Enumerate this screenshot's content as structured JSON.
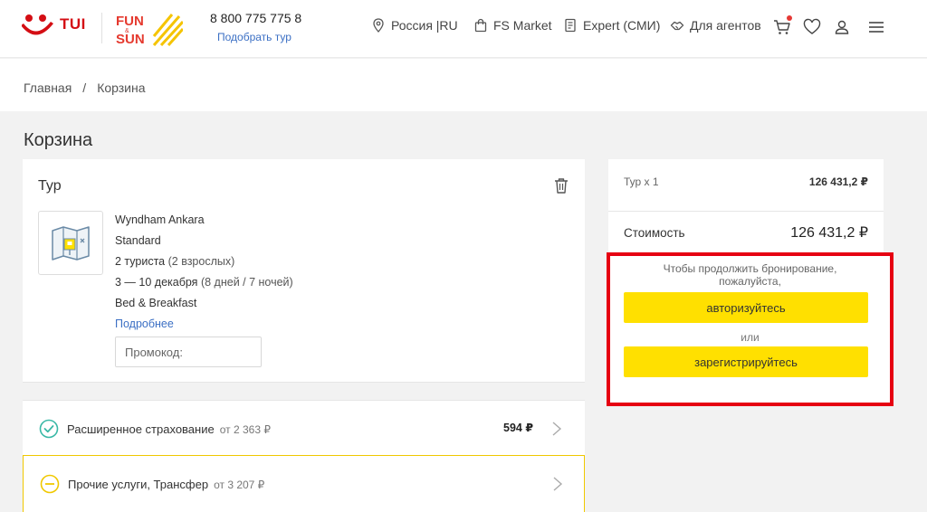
{
  "header": {
    "brand": "TUI",
    "fs_logo": "FUN & SUN",
    "phone": "8 800 775 775 8",
    "pick_tour": "Подобрать тур",
    "nav": [
      {
        "label": "Россия |RU",
        "icon": "location-pin-icon"
      },
      {
        "label": "FS Market",
        "icon": "shopping-bag-icon"
      },
      {
        "label": "Expert (СМИ)",
        "icon": "document-icon"
      },
      {
        "label": "Для агентов",
        "icon": "handshake-icon"
      }
    ],
    "icons": [
      "cart-icon",
      "heart-icon",
      "user-icon",
      "menu-icon"
    ],
    "accent": "#d40e14"
  },
  "breadcrumb": {
    "home": "Главная",
    "separator": "/",
    "current": "Корзина"
  },
  "page": {
    "title": "Корзина"
  },
  "tour": {
    "title": "Тур",
    "hotel": "Wyndham Ankara",
    "room": "Standard",
    "tourists": "2 туриста",
    "tourists_detail": "(2 взрослых)",
    "dates": "3 — 10 декабря",
    "dates_detail": "(8 дней / 7 ночей)",
    "meal": "Bed & Breakfast",
    "more_link": "Подробнее",
    "promo_placeholder": "Промокод:"
  },
  "services": [
    {
      "label": "Расширенное страхование",
      "from": "от 2 363 ₽",
      "price": "594 ₽",
      "icon": "check-circle-icon",
      "color": "#39b8a6"
    },
    {
      "label": "Прочие услуги, Трансфер",
      "from": "от 3 207 ₽",
      "price": "",
      "icon": "minus-circle-icon",
      "color": "#f0c800"
    }
  ],
  "summary": {
    "row_label": "Тур x 1",
    "row_value": "126 431,2 ₽",
    "total_label": "Стоимость",
    "total_value": "126 431,2 ₽",
    "auth_text_1": "Чтобы продолжить бронирование,",
    "auth_text_2": "пожалуйста,",
    "login_button": "авторизуйтесь",
    "or": "или",
    "register_button": "зарегистрируйтесь",
    "button_color": "#ffe000",
    "highlight_color": "#e60012"
  }
}
